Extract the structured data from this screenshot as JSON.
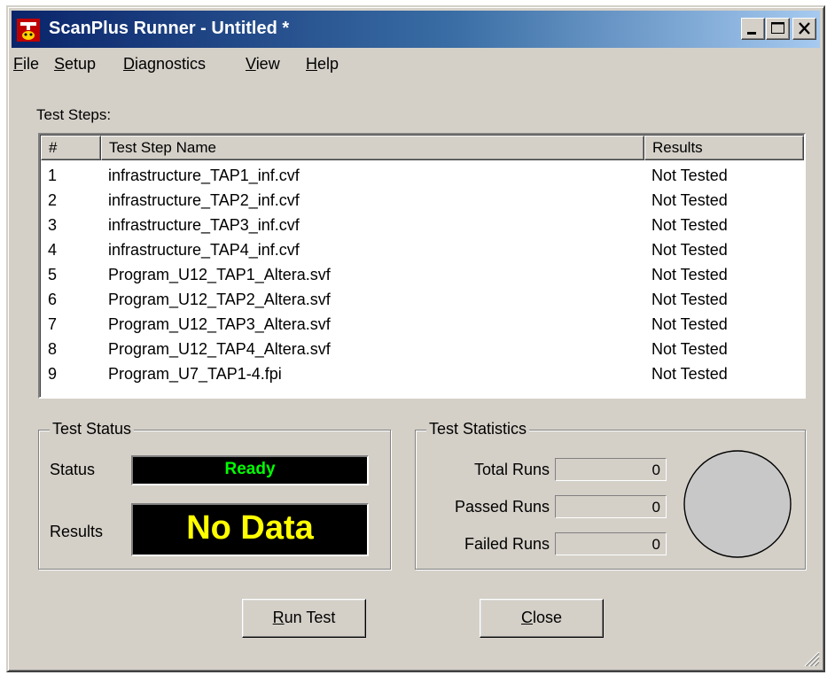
{
  "window": {
    "title": "ScanPlus Runner - Untitled *"
  },
  "menu": [
    {
      "hotkey": "F",
      "rest": "ile"
    },
    {
      "hotkey": "S",
      "rest": "etup"
    },
    {
      "hotkey": "D",
      "rest": "iagnostics"
    },
    {
      "hotkey": "V",
      "rest": "iew"
    },
    {
      "hotkey": "H",
      "rest": "elp"
    }
  ],
  "test_steps": {
    "label": "Test Steps:",
    "columns": [
      "#",
      "Test Step Name",
      "Results"
    ],
    "rows": [
      {
        "num": "1",
        "name": "infrastructure_TAP1_inf.cvf",
        "result": "Not Tested"
      },
      {
        "num": "2",
        "name": "infrastructure_TAP2_inf.cvf",
        "result": "Not Tested"
      },
      {
        "num": "3",
        "name": "infrastructure_TAP3_inf.cvf",
        "result": "Not Tested"
      },
      {
        "num": "4",
        "name": "infrastructure_TAP4_inf.cvf",
        "result": "Not Tested"
      },
      {
        "num": "5",
        "name": "Program_U12_TAP1_Altera.svf",
        "result": "Not Tested"
      },
      {
        "num": "6",
        "name": "Program_U12_TAP2_Altera.svf",
        "result": "Not Tested"
      },
      {
        "num": "7",
        "name": "Program_U12_TAP3_Altera.svf",
        "result": "Not Tested"
      },
      {
        "num": "8",
        "name": "Program_U12_TAP4_Altera.svf",
        "result": "Not Tested"
      },
      {
        "num": "9",
        "name": "Program_U7_TAP1-4.fpi",
        "result": "Not Tested"
      }
    ]
  },
  "test_status": {
    "title": "Test Status",
    "status_label": "Status",
    "status_value": "Ready",
    "status_color": "#00ff00",
    "results_label": "Results",
    "results_value": "No Data",
    "results_color": "#ffff00"
  },
  "test_statistics": {
    "title": "Test Statistics",
    "total_label": "Total Runs",
    "total_value": "0",
    "passed_label": "Passed Runs",
    "passed_value": "0",
    "failed_label": "Failed Runs",
    "failed_value": "0"
  },
  "buttons": {
    "run": {
      "hotkey": "R",
      "rest": "un Test"
    },
    "close": {
      "hotkey": "C",
      "rest": "lose"
    }
  }
}
